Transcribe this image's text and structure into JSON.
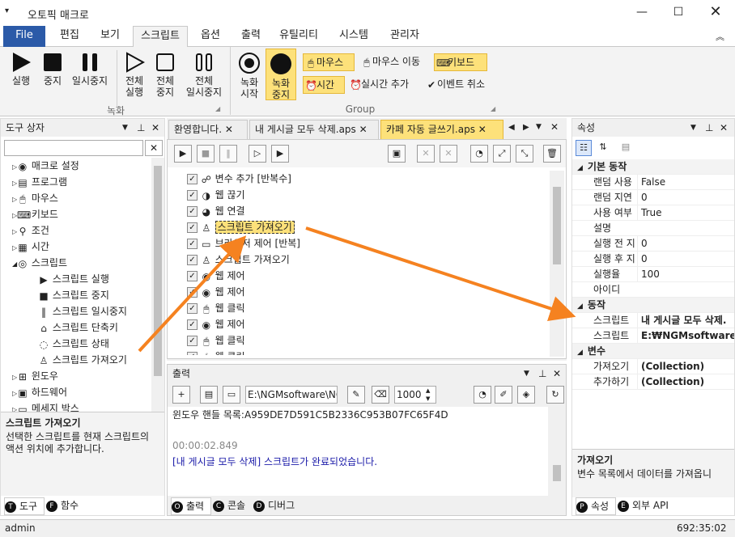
{
  "app": {
    "title": "오토픽 매크로",
    "menu_icon": "menu-icon"
  },
  "ribbon_tabs": [
    {
      "label": "File"
    },
    {
      "label": "편집"
    },
    {
      "label": "보기"
    },
    {
      "label": "스크립트"
    },
    {
      "label": "옵션"
    },
    {
      "label": "출력"
    },
    {
      "label": "유틸리티"
    },
    {
      "label": "시스템"
    },
    {
      "label": "관리자"
    }
  ],
  "ribbon": {
    "run": "실행",
    "stop": "중지",
    "pause": "일시중지",
    "all_run": [
      "전체",
      "실행"
    ],
    "all_stop": [
      "전체",
      "중지"
    ],
    "all_pause": [
      "전체",
      "일시중지"
    ],
    "group1": "녹화",
    "rec_start": [
      "녹화",
      "시작"
    ],
    "rec_stop": [
      "녹화",
      "중지"
    ],
    "mouse": "마우스",
    "mouse_move": "마우스 이동",
    "keyboard": "키보드",
    "time": "시간",
    "realtime_add": "실시간 추가",
    "event_cancel": "이벤트 취소",
    "group2": "Group"
  },
  "toolbox": {
    "title": "도구 상자",
    "items": [
      "매크로 설정",
      "프로그램",
      "마우스",
      "키보드",
      "조건",
      "시간",
      "스크립트"
    ],
    "sub_items": [
      "스크립트 실행",
      "스크립트 중지",
      "스크립트 일시중지",
      "스크립트 단축키",
      "스크립트 상태",
      "스크립트 가져오기"
    ],
    "items_after": [
      "윈도우",
      "하드웨어",
      "메세지 박스"
    ],
    "desc_title": "스크립트 가져오기",
    "desc_text": "선택한 스크립트를 현재 스크립트의 액션 위치에 추가합니다.",
    "tabs": [
      "도구",
      "함수"
    ]
  },
  "doc_tabs": [
    "환영합니다.",
    "내 게시글 모두 삭제.aps",
    "카페 자동 글쓰기.aps"
  ],
  "script_lines": [
    "변수 추가 [반복수]",
    "웹 끊기",
    "웹 연결",
    "스크립트 가져오기",
    "브라우저 제어 [반복]",
    "스크립트 가져오기",
    "웹 제어",
    "웹 제어",
    "웹 클릭",
    "웹 제어",
    "웹 클릭",
    "웹 클릭"
  ],
  "output": {
    "title": "출력",
    "path": "E:\\NGMsoftware\\NG",
    "count": "1000",
    "lines": [
      "윈도우 핸들 목록:A959DE7D591C5B2336C953B07FC65F4D",
      "",
      "00:00:02.849",
      "[내 게시글 모두 삭제] 스크립트가 완료되었습니다."
    ],
    "tabs": [
      "출력",
      "콘솔",
      "디버그"
    ]
  },
  "properties": {
    "title": "속성",
    "basic": "기본 동작",
    "rows": [
      {
        "k": "랜덤 사용",
        "v": "False"
      },
      {
        "k": "랜덤 지연",
        "v": "0"
      },
      {
        "k": "사용 여부",
        "v": "True"
      },
      {
        "k": "설명",
        "v": ""
      },
      {
        "k": "실행 전 지",
        "v": "0"
      },
      {
        "k": "실행 후 지",
        "v": "0"
      },
      {
        "k": "실행율",
        "v": "100"
      },
      {
        "k": "아이디",
        "v": ""
      }
    ],
    "action": "동작",
    "action_rows": [
      {
        "k": "스크립트",
        "v": "내 게시글 모두 삭제."
      },
      {
        "k": "스크립트",
        "v": "E:₩NGMsoftware₩I"
      }
    ],
    "vars": "변수",
    "var_rows": [
      {
        "k": "가져오기",
        "v": "(Collection)"
      },
      {
        "k": "추가하기",
        "v": "(Collection)"
      }
    ],
    "desc_title": "가져오기",
    "desc_text": "변수 목록에서 데이터를 가져옵니",
    "tabs": [
      "속성",
      "외부 API"
    ]
  },
  "status": {
    "user": "admin",
    "coords": "692:35:02"
  },
  "colors": {
    "file_tab": "#2b5aa8",
    "highlight": "#fde17a",
    "arrow": "#f58220"
  }
}
